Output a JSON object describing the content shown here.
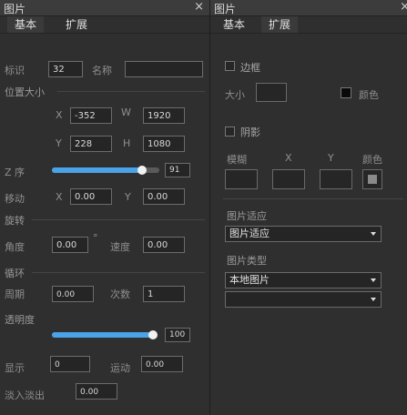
{
  "left_panel": {
    "title": "图片",
    "close_label": "×",
    "tabs": [
      {
        "label": "基本"
      },
      {
        "label": "扩展"
      }
    ],
    "id_label": "标识",
    "id_value": "32",
    "name_label": "名称",
    "name_value": "",
    "position_size_header": "位置大小",
    "x_label": "X",
    "x_value": "-352",
    "w_label": "W",
    "w_value": "1920",
    "y_label": "Y",
    "y_value": "228",
    "h_label": "H",
    "h_value": "1080",
    "z_order_label": "Z 序",
    "z_order_value": "91",
    "z_order_level": 0.85,
    "move_label": "移动",
    "move_x_label": "X",
    "move_x_value": "0.00",
    "move_y_label": "Y",
    "move_y_value": "0.00",
    "rotate_header": "旋转",
    "angle_label": "角度",
    "angle_value": "0.00",
    "degree_symbol": "°",
    "speed_label": "速度",
    "speed_value": "0.00",
    "loop_header": "循环",
    "period_label": "周期",
    "period_value": "0.00",
    "count_label": "次数",
    "count_value": "1",
    "opacity_header": "透明度",
    "opacity_value": "100",
    "opacity_level": 1.0,
    "display_label": "显示",
    "display_value": "0",
    "motion_label": "运动",
    "motion_value": "0.00",
    "fade_label": "淡入淡出",
    "fade_value": "0.00"
  },
  "right_panel": {
    "title": "图片",
    "close_label": "×",
    "tabs": [
      {
        "label": "基本"
      },
      {
        "label": "扩展"
      }
    ],
    "border_label": "边框",
    "size_label": "大小",
    "color_label": "颜色",
    "shadow_label": "阴影",
    "blur_label": "模糊",
    "shadow_x_label": "X",
    "shadow_y_label": "Y",
    "shadow_color_label": "颜色",
    "fit_header": "图片适应",
    "fit_value": "图片适应",
    "type_header": "图片类型",
    "type_value": "本地图片",
    "second_value": ""
  },
  "colors": {
    "accent": "#4aa3e8",
    "background": "#2f2f2f",
    "field_border": "#6c6c6c"
  }
}
